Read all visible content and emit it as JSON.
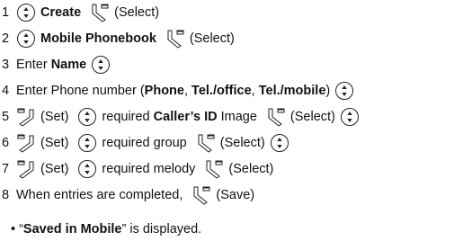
{
  "steps": [
    {
      "num": "1",
      "label_bold": "Create",
      "action": "(Select)"
    },
    {
      "num": "2",
      "label_bold": "Mobile Phonebook",
      "action": "(Select)"
    },
    {
      "num": "3",
      "pre": "Enter ",
      "label_bold": "Name"
    },
    {
      "num": "4",
      "pre": "Enter Phone number (",
      "b1": "Phone",
      "sep1": ", ",
      "b2": "Tel./office",
      "sep2": ", ",
      "b3": "Tel./mobile",
      "post": ")"
    },
    {
      "num": "5",
      "set": "(Set)",
      "pre": "required ",
      "label_bold": "Caller’s ID",
      "post": " Image",
      "action": "(Select)"
    },
    {
      "num": "6",
      "set": "(Set)",
      "text": "required group",
      "action": "(Select)"
    },
    {
      "num": "7",
      "set": "(Set)",
      "text": "required melody",
      "action": "(Select)"
    },
    {
      "num": "8",
      "text": "When entries are completed,",
      "action": "(Save)"
    }
  ],
  "note": {
    "bullet": "•",
    "open_quote": "“",
    "bold": "Saved in Mobile",
    "rest": "” is displayed."
  },
  "icons": {
    "nav_key": "navigation-key-icon",
    "select_key": "right-softkey-icon",
    "set_key": "left-softkey-icon"
  }
}
